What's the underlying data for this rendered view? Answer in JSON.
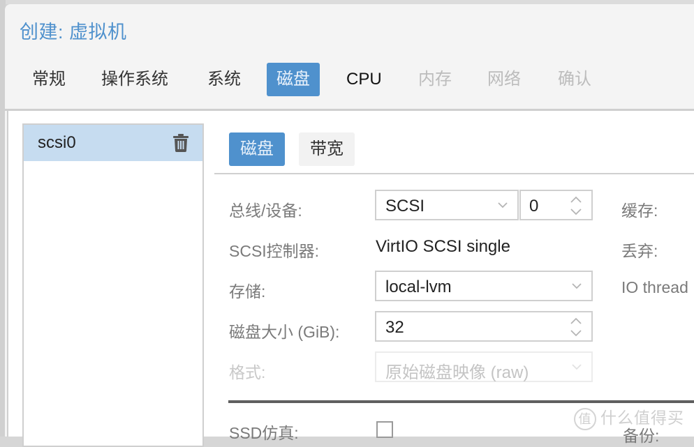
{
  "window": {
    "title": "创建: 虚拟机"
  },
  "tabs": [
    {
      "label": "常规",
      "state": "normal"
    },
    {
      "label": "操作系统",
      "state": "normal"
    },
    {
      "label": "系统",
      "state": "normal"
    },
    {
      "label": "磁盘",
      "state": "active"
    },
    {
      "label": "CPU",
      "state": "normal"
    },
    {
      "label": "内存",
      "state": "disabled"
    },
    {
      "label": "网络",
      "state": "disabled"
    },
    {
      "label": "确认",
      "state": "disabled"
    }
  ],
  "disk_list": {
    "items": [
      {
        "label": "scsi0",
        "selected": true,
        "icon": "trash-icon"
      }
    ]
  },
  "subtabs": [
    {
      "label": "磁盘",
      "state": "active"
    },
    {
      "label": "带宽",
      "state": "normal"
    }
  ],
  "form": {
    "bus_device": {
      "label": "总线/设备:",
      "bus_value": "SCSI",
      "device_value": "0"
    },
    "scsi_controller": {
      "label": "SCSI控制器:",
      "value": "VirtIO SCSI single"
    },
    "storage": {
      "label": "存储:",
      "value": "local-lvm"
    },
    "disk_size": {
      "label": "磁盘大小 (GiB):",
      "value": "32"
    },
    "format": {
      "label": "格式:",
      "value": "原始磁盘映像 (raw)",
      "disabled": true
    },
    "cache": {
      "label": "缓存:"
    },
    "discard": {
      "label": "丢弃:"
    },
    "io_thread": {
      "label": "IO thread"
    },
    "ssd_emulation": {
      "label": "SSD仿真:",
      "checked": false
    },
    "backup": {
      "label": "备份:"
    }
  },
  "watermark": {
    "icon_text": "值",
    "text": "什么值得买"
  },
  "colors": {
    "accent": "#4f91cd",
    "selected_row": "#c6dcf0",
    "disabled_text": "#bcbcbc"
  }
}
